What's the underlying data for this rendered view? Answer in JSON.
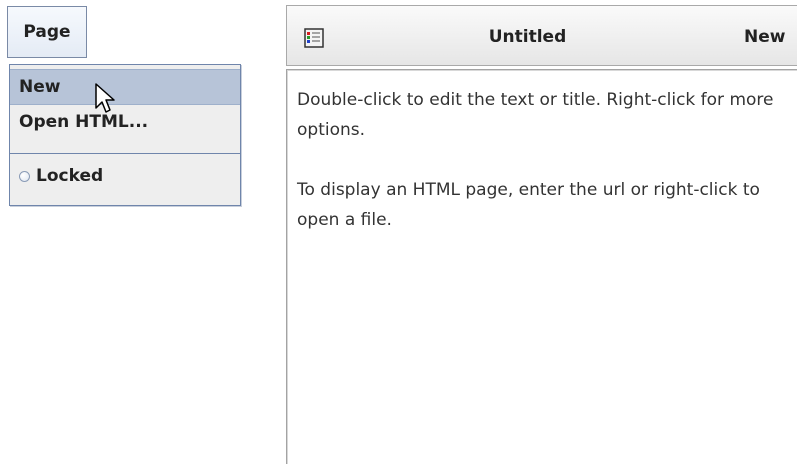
{
  "menu_button": {
    "label": "Page"
  },
  "popup_menu": {
    "items": [
      {
        "label": "New",
        "highlighted": true
      },
      {
        "label": "Open HTML..."
      }
    ],
    "locked": {
      "label": "Locked",
      "checked": false
    }
  },
  "note": {
    "title": "Untitled",
    "new_label": "New",
    "icon": "note-icon",
    "body": [
      "Double-click to edit the text or title. Right-click for more options.",
      "To display an HTML page, enter the url or right-click to open a file."
    ]
  },
  "colors": {
    "menu_highlight": "#b7c4d8",
    "menu_border": "#6f85ab",
    "menu_background": "#eeeeee"
  }
}
